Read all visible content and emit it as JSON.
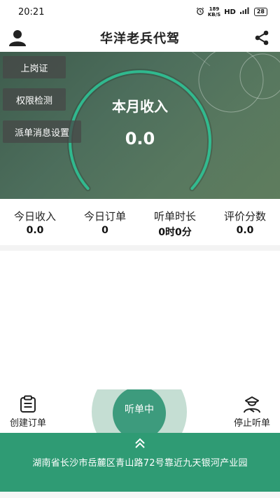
{
  "status_bar": {
    "time": "20:21",
    "speed_value": "189",
    "speed_unit": "KB/S",
    "network": "HD",
    "signal": "5G",
    "battery": "28"
  },
  "header": {
    "title": "华洋老兵代驾",
    "left_icon": "user-icon",
    "right_icon": "share-icon"
  },
  "hero": {
    "buttons": [
      "上岗证",
      "权限检测",
      "派单消息设置"
    ],
    "month_income_label": "本月收入",
    "month_income_value": "0.0",
    "gauge_progress": 0.0
  },
  "stats": [
    {
      "label": "今日收入",
      "value": "0.0"
    },
    {
      "label": "今日订单",
      "value": "0"
    },
    {
      "label": "听单时长",
      "value": "0时0分"
    },
    {
      "label": "评价分数",
      "value": "0.0"
    }
  ],
  "actions": {
    "create_order": "创建订单",
    "listening": "听单中",
    "stop_listening": "停止听单"
  },
  "location": {
    "address": "湖南省长沙市岳麓区青山路72号靠近九天银河产业园"
  },
  "colors": {
    "accent": "#2f9b74",
    "hero_bg": "#4d6e5c",
    "gauge": "#2ec99a"
  }
}
